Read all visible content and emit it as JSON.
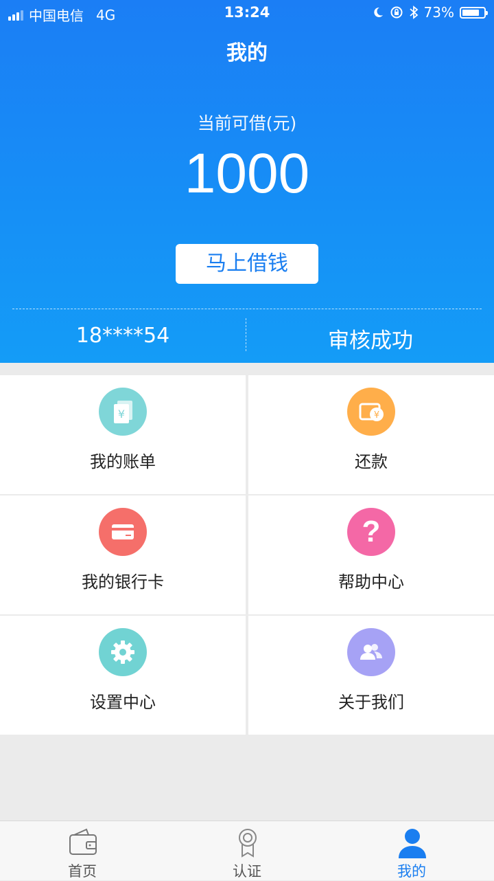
{
  "statusbar": {
    "carrier": "中国电信",
    "network": "4G",
    "time": "13:24",
    "battery": "73%"
  },
  "header": {
    "title": "我的",
    "available_label": "当前可借(元)",
    "available_amount": "1000",
    "borrow_button": "马上借钱",
    "phone": "18****54",
    "review_status": "审核成功"
  },
  "menu": [
    {
      "label": "我的账单",
      "icon": "bill-icon",
      "color": "#7fd6d8"
    },
    {
      "label": "还款",
      "icon": "repay-icon",
      "color": "#ffae4a"
    },
    {
      "label": "我的银行卡",
      "icon": "bank-card-icon",
      "color": "#f56f6a"
    },
    {
      "label": "帮助中心",
      "icon": "help-icon",
      "color": "#f468a6"
    },
    {
      "label": "设置中心",
      "icon": "settings-icon",
      "color": "#71d3d3"
    },
    {
      "label": "关于我们",
      "icon": "about-icon",
      "color": "#a6a2f5"
    }
  ],
  "tabbar": [
    {
      "label": "首页",
      "icon": "wallet-icon"
    },
    {
      "label": "认证",
      "icon": "badge-icon"
    },
    {
      "label": "我的",
      "icon": "user-icon",
      "active": true
    }
  ],
  "colors": {
    "primary": "#1a7ef0",
    "accent_text": "#1a7ef0"
  }
}
